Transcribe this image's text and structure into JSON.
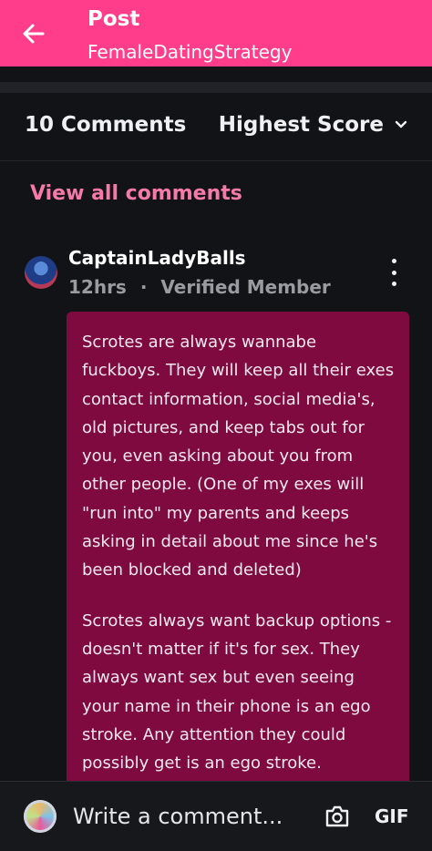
{
  "header": {
    "title": "Post",
    "subtitle": "FemaleDatingStrategy",
    "accent": "#ff3d8a"
  },
  "toolbar": {
    "comment_count": "10 Comments",
    "sort_label": "Highest Score"
  },
  "view_all": "View all comments",
  "comment": {
    "username": "CaptainLadyBalls",
    "time": "12hrs",
    "separator": "·",
    "flair": "Verified Member",
    "paragraphs": [
      "Scrotes are always wannabe fuckboys. They will keep all their exes contact information, social media's, old pictures, and keep tabs out for you, even asking about you from other people. (One of my exes will \"run into\" my parents and keeps asking in detail about me since he's been blocked and deleted)",
      "Scrotes always want backup options - doesn't matter if it's for sex. They always want sex but even seeing your name in their phone is an ego stroke. Any attention they could possibly get is an ego stroke."
    ],
    "bubble_color": "#7e0a40"
  },
  "composer": {
    "placeholder": "Write a comment...",
    "gif_label": "GIF"
  },
  "icons": [
    "back-arrow-icon",
    "chevron-down-icon",
    "more-vertical-icon",
    "camera-icon"
  ]
}
